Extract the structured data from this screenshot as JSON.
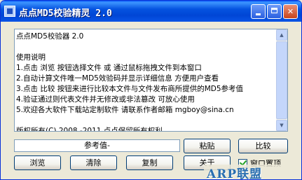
{
  "window": {
    "title": "点点MD5校验精灵 2.0"
  },
  "titlebar": {
    "minimize_label": "",
    "maximize_label": "",
    "close_label": "✕"
  },
  "info": {
    "lines": [
      "点点MD5校验器 2.0",
      "",
      "使用说明",
      "1.点击 浏览 按钮选择文件 或 通过鼠标拖拽文件到本窗口",
      "2.自动计算文件唯一MD5效验码并显示详细信息 方便用户查看",
      "3.点击 比较 按钮来进行比较本文件与文件发布商所提供的MD5参考值",
      "4.验证通过则代表文件并无修改或非法篡改 可放心使用",
      "5.欢迎各大软件下载站定制软件 请联系作者邮箱 mgboy@sina.cn",
      "",
      "版权所有(C) 2008 -2011 点点保留所有权利"
    ]
  },
  "reference": {
    "value": "参考值-"
  },
  "buttons": {
    "paste": "粘贴",
    "compare": "比较",
    "browse": "浏览",
    "clear": "清除",
    "copy": "复制",
    "about": "关于"
  },
  "ontop": {
    "label": "窗口置顶",
    "checked": true
  },
  "watermark": {
    "text": "ARP联盟"
  },
  "icons": {
    "scroll_up": "▲",
    "scroll_down": "▼"
  }
}
